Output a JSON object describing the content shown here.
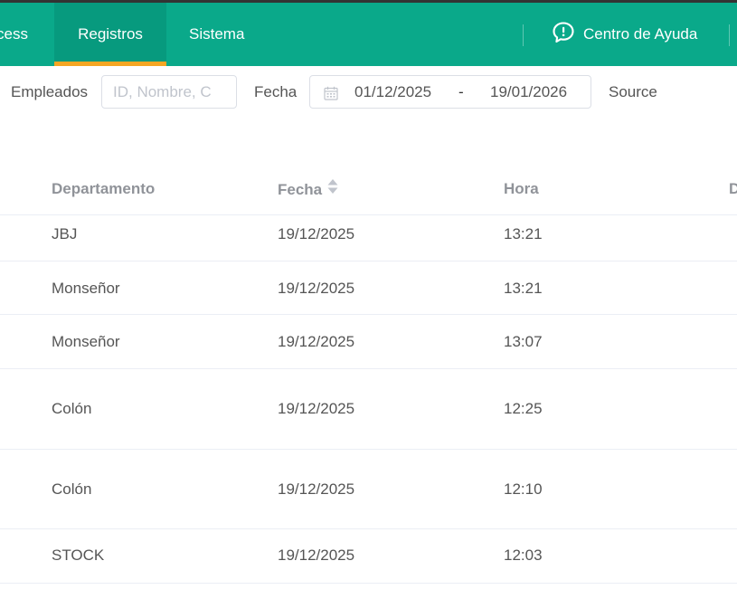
{
  "nav": {
    "tabs": [
      {
        "label": "cess"
      },
      {
        "label": "Registros"
      },
      {
        "label": "Sistema"
      }
    ],
    "help_label": "Centro de Ayuda",
    "accent_color": "#0aa98a",
    "active_indicator_color": "#f5a623"
  },
  "filters": {
    "employees_label": "Empleados",
    "employees_placeholder": "ID, Nombre, C",
    "date_label": "Fecha",
    "date_start": "01/12/2025",
    "date_separator": "-",
    "date_end": "19/01/2026",
    "source_label": "Source"
  },
  "table": {
    "columns": [
      "Departamento",
      "Fecha",
      "Hora",
      "D"
    ],
    "rows": [
      {
        "departamento": "JBJ",
        "fecha": "19/12/2025",
        "hora": "13:21"
      },
      {
        "departamento": "Monseñor",
        "fecha": "19/12/2025",
        "hora": "13:21"
      },
      {
        "departamento": "Monseñor",
        "fecha": "19/12/2025",
        "hora": "13:07"
      },
      {
        "departamento": "Colón",
        "fecha": "19/12/2025",
        "hora": "12:25"
      },
      {
        "departamento": "Colón",
        "fecha": "19/12/2025",
        "hora": "12:10"
      },
      {
        "departamento": "STOCK",
        "fecha": "19/12/2025",
        "hora": "12:03"
      }
    ]
  }
}
